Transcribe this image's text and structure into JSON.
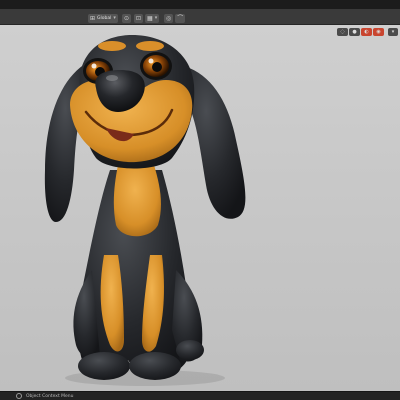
{
  "header": {
    "view_mode": "Global",
    "buttons": [
      {
        "icon": "transform-orientation-icon"
      },
      {
        "icon": "pivot-icon"
      },
      {
        "icon": "snap-icon"
      },
      {
        "icon": "proportional-edit-icon"
      }
    ]
  },
  "viewport": {
    "shading_modes": [
      "wireframe",
      "solid",
      "material",
      "rendered"
    ],
    "active_shading": "rendered"
  },
  "statusbar": {
    "hint": "Object Context Menu"
  }
}
